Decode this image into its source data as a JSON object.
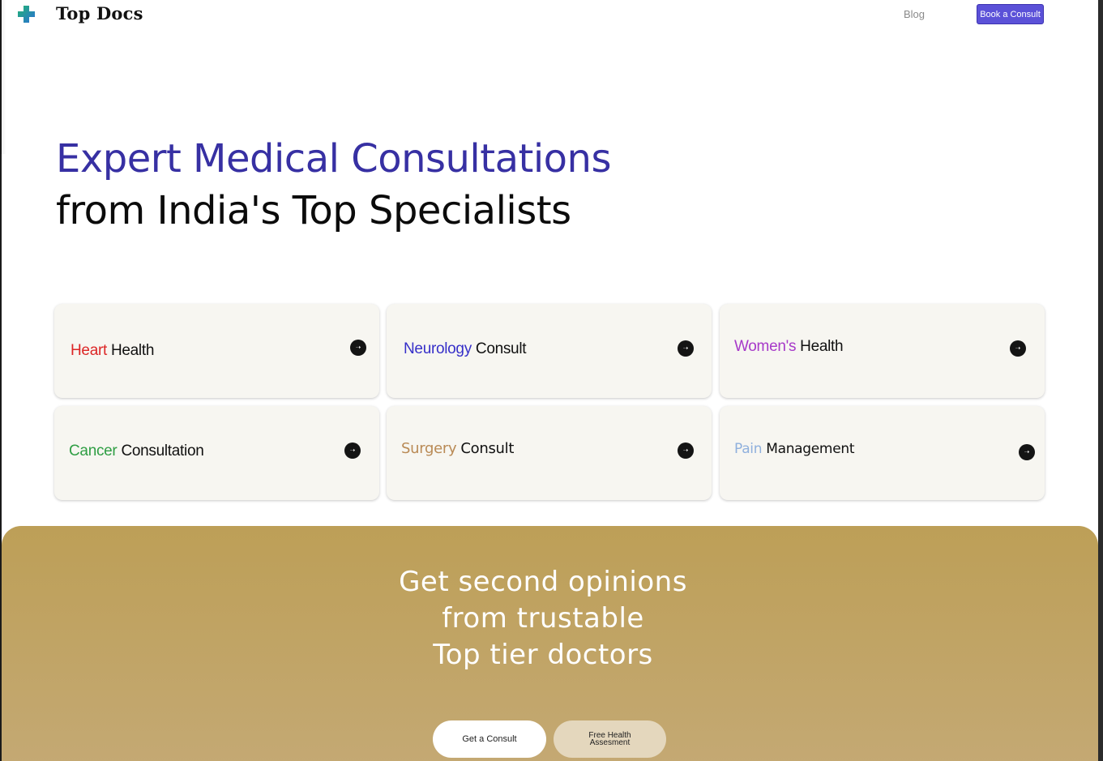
{
  "header": {
    "brand": "Top Docs",
    "nav_blog": "Blog",
    "book_button": "Book a Consult",
    "logo_colors": {
      "primary": "#1b9e8a",
      "secondary": "#2a6fd6"
    }
  },
  "hero": {
    "line1": "Expert Medical Consultations",
    "line2": "from India's Top Specialists",
    "accent_color": "#3730a3"
  },
  "cards": [
    {
      "accent": "Heart",
      "rest": "Health",
      "accent_color": "#dc2626",
      "icon": "arrow-right-icon"
    },
    {
      "accent": "Neurology",
      "rest": "Consult",
      "accent_color": "#3730c9",
      "icon": "arrow-right-icon"
    },
    {
      "accent": "Women's",
      "rest": "Health",
      "accent_color": "#a73ac9",
      "icon": "arrow-right-icon"
    },
    {
      "accent": "Cancer",
      "rest": "Consultation",
      "accent_color": "#2f9e44",
      "icon": "arrow-right-icon"
    },
    {
      "accent": "Surgery",
      "rest": "Consult",
      "accent_color": "#b98a55",
      "icon": "arrow-right-icon"
    },
    {
      "accent": "Pain",
      "rest": "Management",
      "accent_color": "#8fb0dd",
      "icon": "arrow-right-icon"
    }
  ],
  "banner": {
    "line1": "Get second opinions",
    "line2": "from trustable",
    "line3": "Top tier doctors",
    "consult_button": "Get a Consult",
    "free_button_line1": "Free Health",
    "free_button_line2": "Assesment",
    "color": "#c1a466"
  }
}
